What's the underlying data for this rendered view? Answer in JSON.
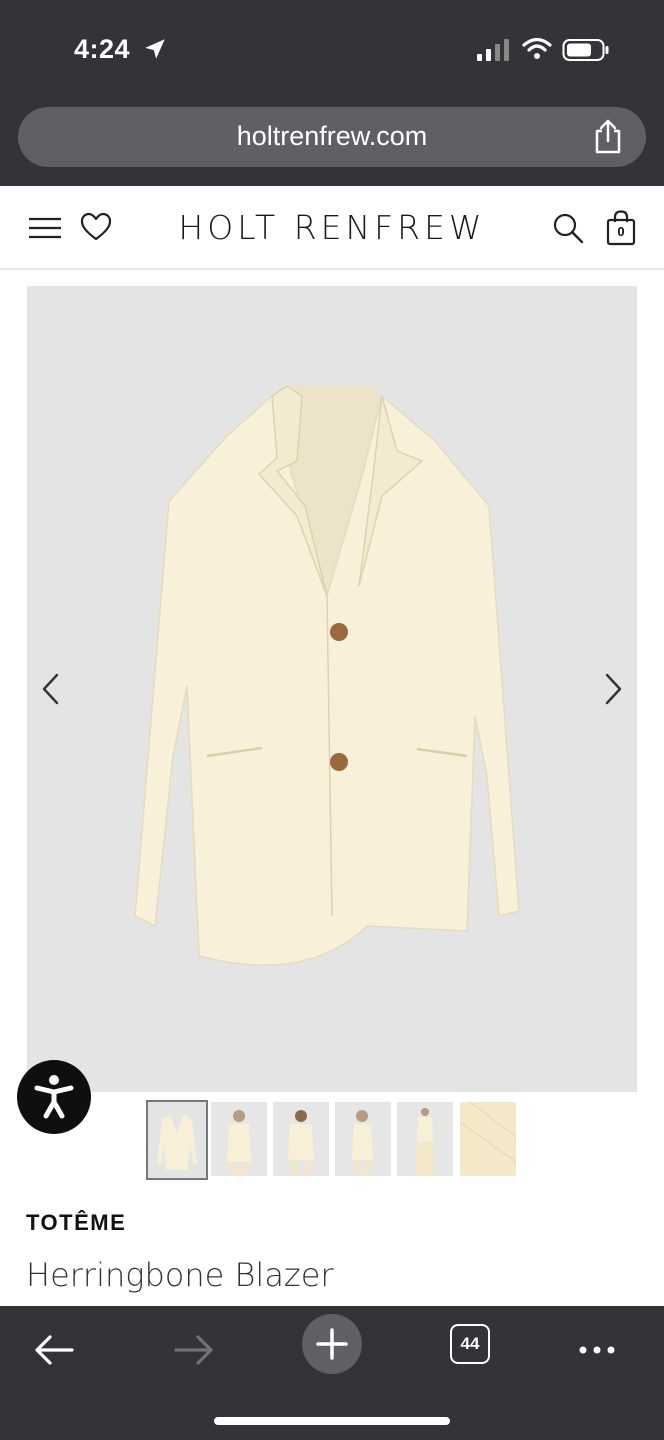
{
  "status_bar": {
    "time": "4:24",
    "icons": [
      "location-arrow-icon",
      "cellular-signal-icon",
      "wifi-icon",
      "battery-icon"
    ]
  },
  "browser": {
    "url": "holtrenfrew.com",
    "share_icon": "share-icon",
    "tabs_count": "44",
    "toolbar_icons": [
      "back-arrow-icon",
      "forward-arrow-icon",
      "plus-icon",
      "tabs-icon",
      "more-icon"
    ]
  },
  "site_header": {
    "logo": "HOLT RENFREW",
    "icons": [
      "hamburger-icon",
      "heart-icon",
      "search-icon",
      "shopping-bag-icon"
    ],
    "bag_count": "0"
  },
  "product": {
    "brand": "TOTÊME",
    "name": "Herringbone Blazer",
    "image_count": 6,
    "active_image": 1,
    "colors": {
      "blazer": "#f8f0d8",
      "image_bg": "#e4e4e4"
    }
  },
  "colors": {
    "chrome": "#323437",
    "url_pill": "#5e6064",
    "text_dark": "#111111"
  }
}
